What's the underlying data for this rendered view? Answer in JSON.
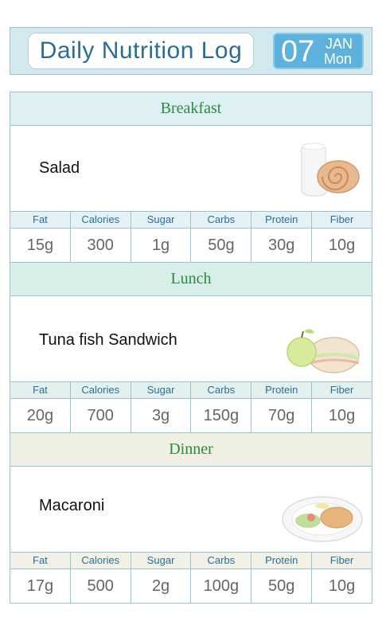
{
  "header": {
    "title": "Daily Nutrition Log",
    "date_day": "07",
    "date_month": "JAN",
    "date_weekday": "Mon"
  },
  "nutrient_labels": [
    "Fat",
    "Calories",
    "Sugar",
    "Carbs",
    "Protein",
    "Fiber"
  ],
  "meals": [
    {
      "section": "Breakfast",
      "food": "Salad",
      "image_icon": "milk-and-cinnamon-roll-icon",
      "values": [
        "15g",
        "300",
        "1g",
        "50g",
        "30g",
        "10g"
      ]
    },
    {
      "section": "Lunch",
      "food": "Tuna fish Sandwich",
      "image_icon": "apple-and-sandwich-icon",
      "values": [
        "20g",
        "700",
        "3g",
        "150g",
        "70g",
        "10g"
      ]
    },
    {
      "section": "Dinner",
      "food": "Macaroni",
      "image_icon": "plate-with-food-icon",
      "values": [
        "17g",
        "500",
        "2g",
        "100g",
        "50g",
        "10g"
      ]
    }
  ],
  "colors": {
    "title": "#2a6e97",
    "accent_blue": "#5db1dd",
    "section_text": "#2b8a3c",
    "border": "#9cc2cf"
  }
}
